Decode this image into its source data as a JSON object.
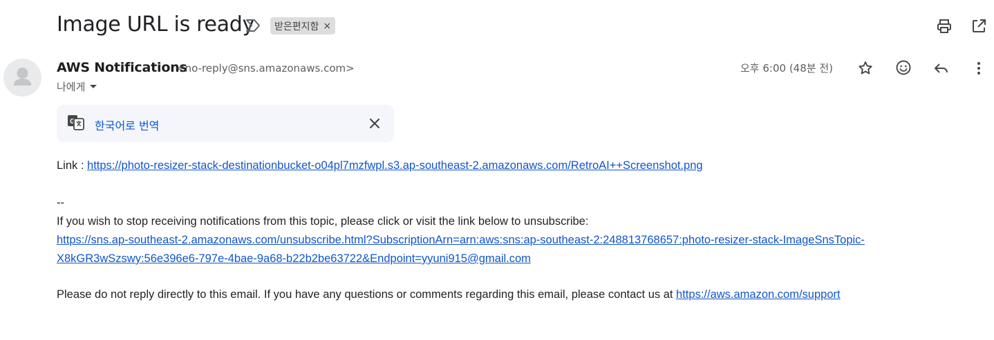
{
  "email": {
    "subject": "Image URL is ready",
    "label_chip": "받은편지함",
    "label_remove": "×",
    "sender_name": "AWS Notifications",
    "sender_email": "<no-reply@sns.amazonaws.com>",
    "recipient": "나에게",
    "time": "오후 6:00 (48분 전)"
  },
  "toolbar": {
    "print_icon": "print-icon",
    "open_new_window_icon": "open-in-new-window-icon",
    "star_icon": "star-icon",
    "emoji_icon": "emoji-icon",
    "reply_icon": "reply-icon",
    "more_icon": "more-vert-icon"
  },
  "translate": {
    "label": "한국어로 번역"
  },
  "body": {
    "link_prefix": "Link : ",
    "image_link": "https://photo-resizer-stack-destinationbucket-o04pl7mzfwpl.s3.ap-southeast-2.amazonaws.com/RetroAI++Screenshot.png",
    "separator": "--",
    "unsubscribe_text": "If you wish to stop receiving notifications from this topic, please click or visit the link below to unsubscribe:",
    "unsubscribe_link_line1": "https://sns.ap-southeast-2.amazonaws.com/unsubscribe.html?SubscriptionArn=arn:aws:sns:ap-southeast-2:248813768657:photo-resizer-stack-ImageSnsTopic-",
    "unsubscribe_link_line2": "X8kGR3wSzswy:56e396e6-797e-4bae-9a68-b22b2be63722&Endpoint=yyuni915@gmail.com",
    "contact_text": "Please do not reply directly to this email. If you have any questions or comments regarding this email, please contact us at ",
    "support_link": "https://aws.amazon.com/support"
  },
  "colors": {
    "link": "#1155cc",
    "translate_link": "#0b57d0",
    "chip_bg": "#dddddd",
    "translate_bg": "#f4f6fb"
  }
}
